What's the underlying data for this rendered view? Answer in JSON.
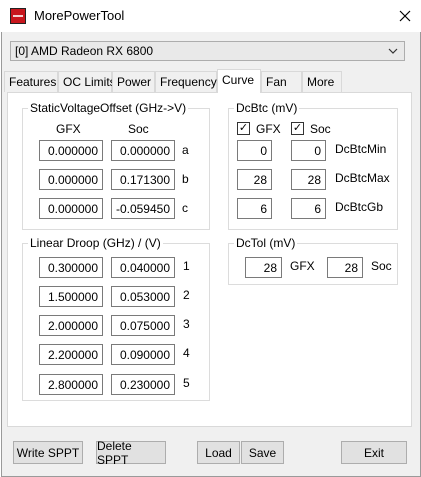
{
  "window": {
    "title": "MorePowerTool"
  },
  "gpu_select": {
    "value": "[0] AMD Radeon RX 6800"
  },
  "tabs": [
    {
      "label": "Features"
    },
    {
      "label": "OC Limits"
    },
    {
      "label": "Power"
    },
    {
      "label": "Frequency"
    },
    {
      "label": "Curve",
      "active": true
    },
    {
      "label": "Fan"
    },
    {
      "label": "More"
    }
  ],
  "svo": {
    "title": "StaticVoltageOffset (GHz->V)",
    "col_gfx": "GFX",
    "col_soc": "Soc",
    "rows": [
      {
        "gfx": "0.000000",
        "soc": "0.000000",
        "label": "a"
      },
      {
        "gfx": "0.000000",
        "soc": "0.171300",
        "label": "b"
      },
      {
        "gfx": "0.000000",
        "soc": "-0.059450",
        "label": "c"
      }
    ]
  },
  "droop": {
    "title": "Linear Droop (GHz) / (V)",
    "rows": [
      {
        "gfx": "0.300000",
        "soc": "0.040000",
        "label": "1"
      },
      {
        "gfx": "1.500000",
        "soc": "0.053000",
        "label": "2"
      },
      {
        "gfx": "2.000000",
        "soc": "0.075000",
        "label": "3"
      },
      {
        "gfx": "2.200000",
        "soc": "0.090000",
        "label": "4"
      },
      {
        "gfx": "2.800000",
        "soc": "0.230000",
        "label": "5"
      }
    ]
  },
  "dcbtc": {
    "title": "DcBtc (mV)",
    "gfx_label": "GFX",
    "soc_label": "Soc",
    "gfx_checked": true,
    "soc_checked": true,
    "check_glyph": "✓",
    "rows": [
      {
        "gfx": "0",
        "soc": "0",
        "label": "DcBtcMin"
      },
      {
        "gfx": "28",
        "soc": "28",
        "label": "DcBtcMax"
      },
      {
        "gfx": "6",
        "soc": "6",
        "label": "DcBtcGb"
      }
    ]
  },
  "dctol": {
    "title": "DcTol (mV)",
    "gfx_value": "28",
    "gfx_label": "GFX",
    "soc_value": "28",
    "soc_label": "Soc"
  },
  "buttons": {
    "write_sppt": "Write SPPT",
    "delete_sppt": "Delete SPPT",
    "load": "Load",
    "save": "Save",
    "exit": "Exit"
  }
}
